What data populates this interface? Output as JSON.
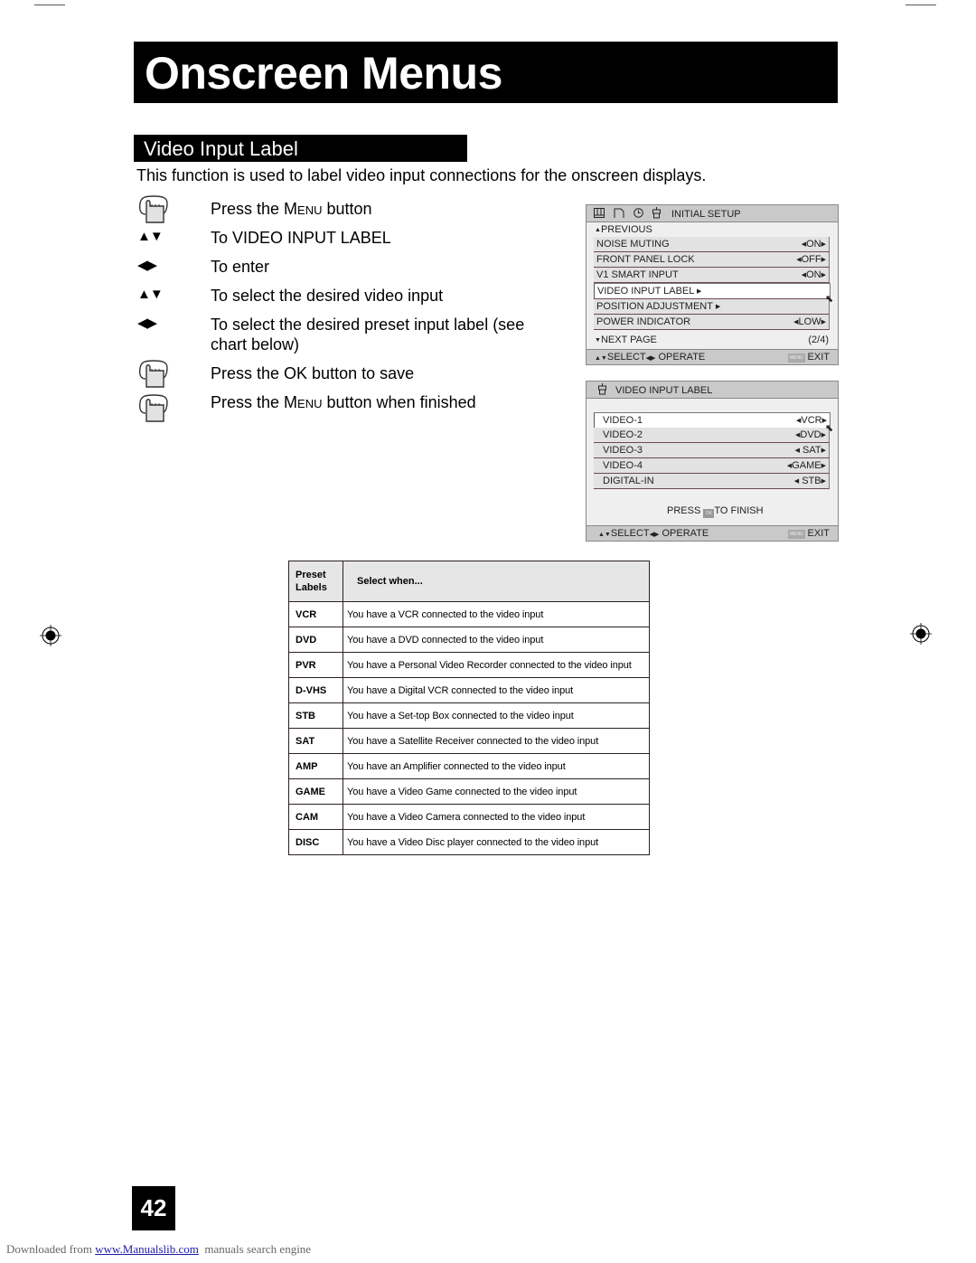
{
  "page": {
    "title": "Onscreen Menus",
    "section_title": "Video Input Label",
    "intro": "This function is used to label video input connections for the onscreen displays.",
    "page_number": "42"
  },
  "steps": [
    {
      "icon": "hand-press-icon",
      "pre": "Press the ",
      "smallcaps_first": "M",
      "smallcaps_rest": "ENU",
      "post": " button"
    },
    {
      "icon": "up-down-arrows-icon",
      "text": "To VIDEO INPUT LABEL"
    },
    {
      "icon": "left-right-arrows-icon",
      "text": "To enter"
    },
    {
      "icon": "up-down-arrows-icon",
      "text": "To select the desired video input"
    },
    {
      "icon": "left-right-arrows-icon",
      "text": "To select the desired preset input label (see chart below)"
    },
    {
      "icon": "hand-press-icon",
      "text": "Press the OK button to save"
    },
    {
      "icon": "hand-press-icon",
      "pre": "Press the ",
      "smallcaps_first": "M",
      "smallcaps_rest": "ENU",
      "post": " button when finished"
    }
  ],
  "osd_initial_setup": {
    "header": "INITIAL SETUP",
    "header_icons": [
      "picture-icon",
      "sound-icon",
      "clock-icon",
      "setup-icon"
    ],
    "previous": "PREVIOUS",
    "items": [
      {
        "label": "NOISE MUTING",
        "value": "ON"
      },
      {
        "label": "FRONT PANEL LOCK",
        "value": "OFF"
      },
      {
        "label": "V1 SMART INPUT",
        "value": "ON"
      },
      {
        "label": "VIDEO INPUT LABEL",
        "value": "",
        "selected": true,
        "submenu": true
      },
      {
        "label": "POSITION ADJUSTMENT",
        "value": "",
        "submenu": true
      },
      {
        "label": "POWER INDICATOR",
        "value": "LOW"
      }
    ],
    "next_page": "NEXT PAGE",
    "page_indicator": "(2/4)",
    "footer_select": "SELECT",
    "footer_operate": "OPERATE",
    "footer_menu_badge": "MENU",
    "footer_exit": "EXIT"
  },
  "osd_video_input_label": {
    "header": "VIDEO INPUT LABEL",
    "items": [
      {
        "label": "VIDEO-1",
        "value": "VCR",
        "selected": true
      },
      {
        "label": "VIDEO-2",
        "value": "DVD"
      },
      {
        "label": "VIDEO-3",
        "value": "SAT"
      },
      {
        "label": "VIDEO-4",
        "value": "GAME"
      },
      {
        "label": "DIGITAL-IN",
        "value": "STB"
      }
    ],
    "press_text": "PRESS",
    "ok_badge": "OK",
    "finish_text": "TO FINISH",
    "footer_select": "SELECT",
    "footer_operate": "OPERATE",
    "footer_menu_badge": "MENU",
    "footer_exit": "EXIT"
  },
  "preset_table": {
    "header_label": "Preset Labels",
    "header_label_line1": "Preset",
    "header_label_line2": "Labels",
    "header_desc": "Select when...",
    "rows": [
      {
        "label": "VCR",
        "desc": "You have a VCR connected to the video input"
      },
      {
        "label": "DVD",
        "desc": "You have a DVD connected to the video input"
      },
      {
        "label": "PVR",
        "desc": "You have a Personal Video Recorder connected to the video input"
      },
      {
        "label": "D-VHS",
        "desc": "You have a Digital VCR connected to the video input"
      },
      {
        "label": "STB",
        "desc": "You have a Set-top Box connected to the video input"
      },
      {
        "label": "SAT",
        "desc": "You have a Satellite Receiver connected to the video input"
      },
      {
        "label": "AMP",
        "desc": "You have an Amplifier connected to the video input"
      },
      {
        "label": "GAME",
        "desc": "You have a Video Game connected to the video input"
      },
      {
        "label": "CAM",
        "desc": "You have a Video Camera connected to the video input"
      },
      {
        "label": "DISC",
        "desc": "You have a Video Disc player connected to the video input"
      }
    ]
  },
  "footer": {
    "prefix": "Downloaded from ",
    "link": "www.Manualslib.com",
    "suffix": "  manuals search engine"
  }
}
